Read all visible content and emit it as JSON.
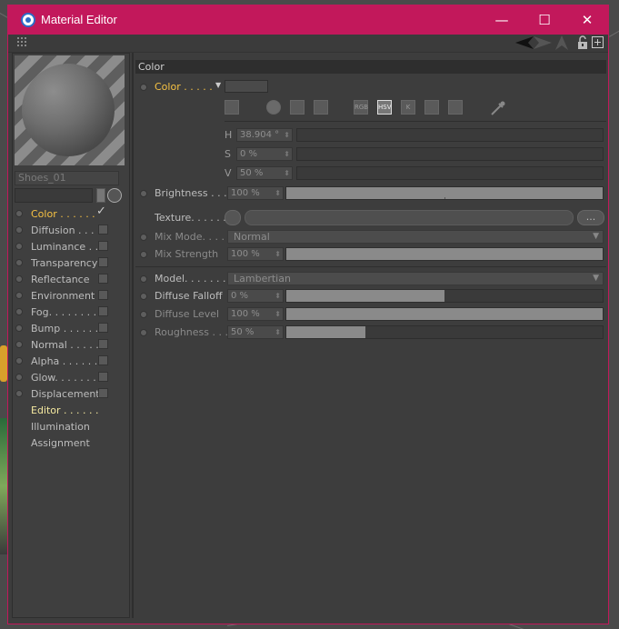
{
  "window": {
    "title": "Material Editor",
    "minimize_glyph": "—",
    "maximize_glyph": "☐",
    "close_glyph": "✕",
    "accent_color": "#c2185b"
  },
  "toolbar": {
    "icons": [
      "grid-icon",
      "arrow-left-icon",
      "arrow-right-icon",
      "up-icon",
      "lock-icon",
      "new-window-icon"
    ]
  },
  "material": {
    "name": "Shoes_01"
  },
  "channels": [
    {
      "label": "Color . . . . . .",
      "state": "active",
      "checked": true
    },
    {
      "label": "Diffusion . . .",
      "state": "normal",
      "checked": false
    },
    {
      "label": "Luminance . .",
      "state": "normal",
      "checked": false
    },
    {
      "label": "Transparency",
      "state": "normal",
      "checked": false
    },
    {
      "label": "Reflectance",
      "state": "normal",
      "checked": false
    },
    {
      "label": "Environment",
      "state": "normal",
      "checked": false
    },
    {
      "label": "Fog. . . . . . . .",
      "state": "normal",
      "checked": false
    },
    {
      "label": "Bump . . . . . .",
      "state": "normal",
      "checked": false
    },
    {
      "label": "Normal . . . . .",
      "state": "normal",
      "checked": false
    },
    {
      "label": "Alpha . . . . . .",
      "state": "normal",
      "checked": false
    },
    {
      "label": "Glow. . . . . . .",
      "state": "normal",
      "checked": false
    },
    {
      "label": "Displacement",
      "state": "normal",
      "checked": false
    },
    {
      "label": "Editor . . . . . .",
      "state": "editor",
      "checked": null
    },
    {
      "label": "Illumination",
      "state": "plain",
      "checked": null
    },
    {
      "label": "Assignment",
      "state": "plain",
      "checked": null
    }
  ],
  "color_section": {
    "header": "Color",
    "color_label": "Color . . . . .",
    "color_value": "#4a4a4a",
    "mode_icons": [
      "color-wheel-icon",
      "spectrum-icon",
      "picture-icon",
      "rgb-icon",
      "hsv-icon",
      "kelvin-icon",
      "mixer-icon",
      "swatches-icon",
      "eyedropper-icon"
    ],
    "mode_labels": {
      "rgb": "RGB",
      "hsv": "HSV",
      "k": "K"
    },
    "h": {
      "label": "H",
      "value": "38.904 °"
    },
    "s": {
      "label": "S",
      "value": "0 %"
    },
    "v": {
      "label": "V",
      "value": "50 %"
    },
    "brightness": {
      "label": "Brightness . . .",
      "value": "100 %",
      "fraction": 1.0
    },
    "texture": {
      "label": "Texture. . . . . .",
      "more": "..."
    },
    "mix_mode": {
      "label": "Mix Mode. . . .",
      "value": "Normal"
    },
    "mix_strength": {
      "label": "Mix Strength",
      "value": "100 %",
      "fraction": 1.0
    }
  },
  "model_section": {
    "model": {
      "label": "Model. . . . . . .",
      "value": "Lambertian"
    },
    "diffuse_falloff": {
      "label": "Diffuse Falloff",
      "value": "0 %",
      "fraction": 0.5
    },
    "diffuse_level": {
      "label": "Diffuse Level",
      "value": "100 %",
      "fraction": 1.0
    },
    "roughness": {
      "label": "Roughness . . .",
      "value": "50 %",
      "fraction": 0.25
    }
  }
}
